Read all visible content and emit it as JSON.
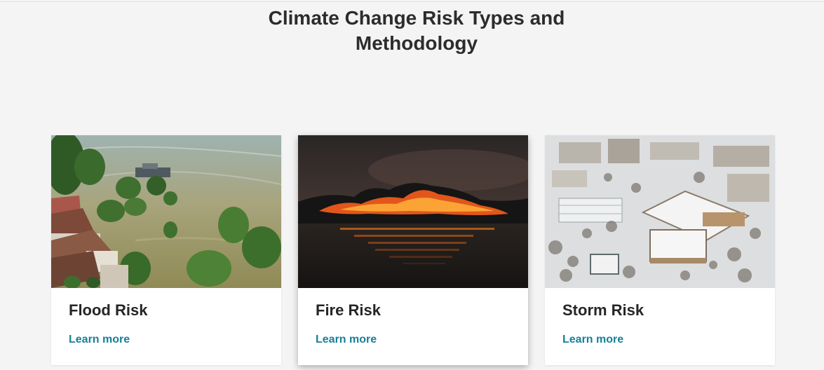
{
  "header": {
    "title_line1": "Climate Change Risk Types and",
    "title_line2": "Methodology"
  },
  "cards": [
    {
      "title": "Flood Risk",
      "link_label": "Learn more",
      "image": "flooded-town-photo"
    },
    {
      "title": "Fire Risk",
      "link_label": "Learn more",
      "image": "wildfire-night-photo"
    },
    {
      "title": "Storm Risk",
      "link_label": "Learn more",
      "image": "snow-covered-city-photo"
    }
  ],
  "colors": {
    "background": "#f4f4f4",
    "card": "#ffffff",
    "link": "#17809a",
    "heading": "#2c2c2c"
  }
}
